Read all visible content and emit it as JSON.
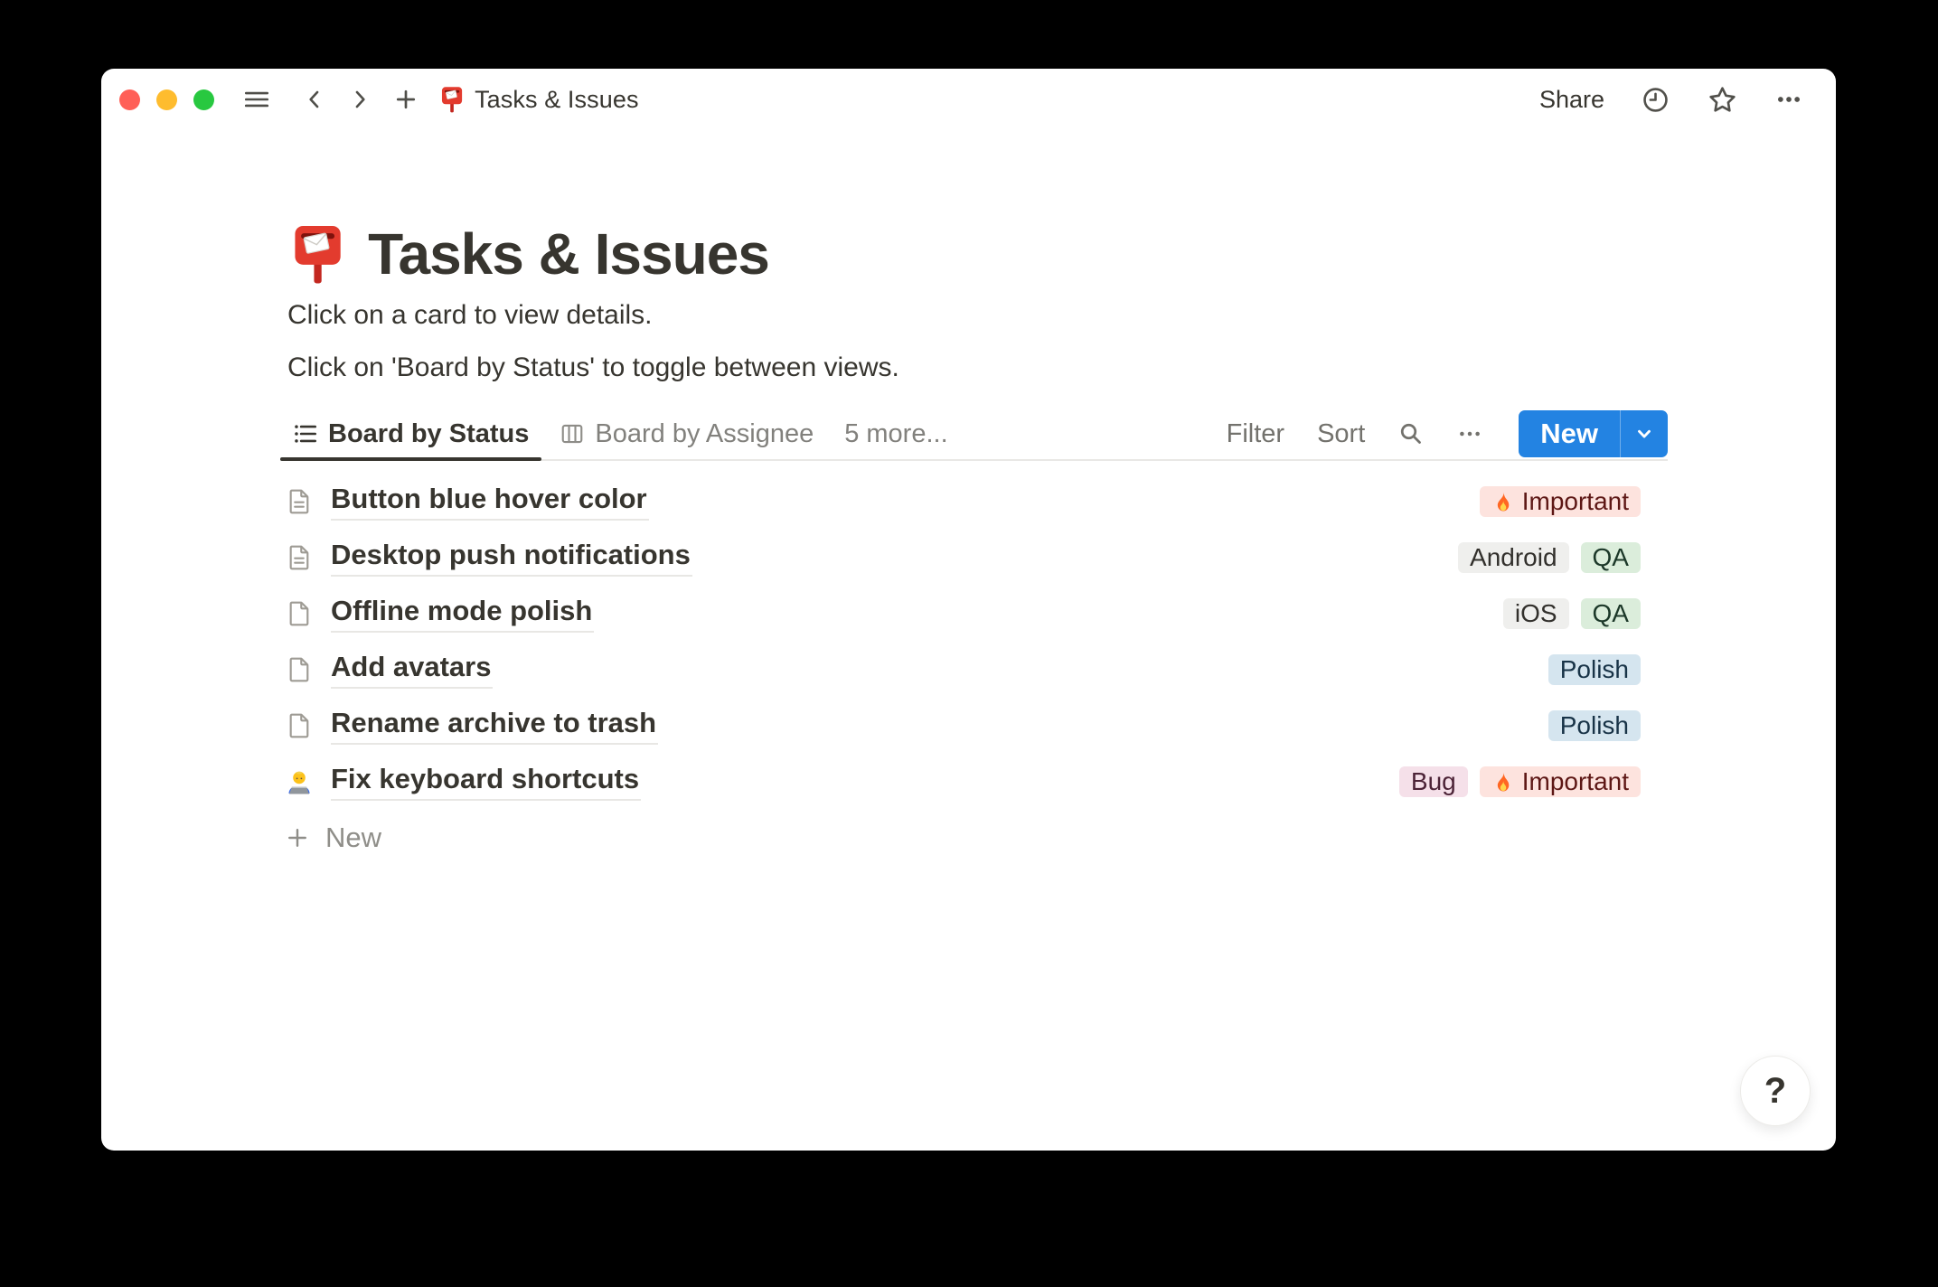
{
  "titlebar": {
    "breadcrumb": "Tasks & Issues",
    "share_label": "Share",
    "icons": [
      "sidebar-menu-icon",
      "back-icon",
      "forward-icon",
      "new-tab-icon",
      "mailbox-icon",
      "clock-icon",
      "star-icon",
      "more-icon"
    ]
  },
  "page": {
    "emoji": "mailbox-emoji",
    "title": "Tasks & Issues",
    "description_line1": "Click on a card to view details.",
    "description_line2": "Click on 'Board by Status' to toggle between views.",
    "new_row_label": "New",
    "help_label": "?"
  },
  "tabs": [
    {
      "label": "Board by Status",
      "icon": "list-view",
      "active": true
    },
    {
      "label": "Board by Assignee",
      "icon": "board-view",
      "active": false
    },
    {
      "label": "5 more...",
      "icon": null,
      "active": false
    }
  ],
  "view_controls": {
    "filter_label": "Filter",
    "sort_label": "Sort",
    "new_label": "New",
    "icons": [
      "search-icon",
      "view-options-icon",
      "chevron-down-icon"
    ]
  },
  "rows": [
    {
      "icon": "page-text",
      "title": "Button blue hover color",
      "tags": [
        {
          "label": "Important",
          "color": "red",
          "flame": true
        }
      ]
    },
    {
      "icon": "page-text",
      "title": "Desktop push notifications",
      "tags": [
        {
          "label": "Android",
          "color": "gray"
        },
        {
          "label": "QA",
          "color": "green"
        }
      ]
    },
    {
      "icon": "page-blank",
      "title": "Offline mode polish",
      "tags": [
        {
          "label": "iOS",
          "color": "gray"
        },
        {
          "label": "QA",
          "color": "green"
        }
      ]
    },
    {
      "icon": "page-blank",
      "title": "Add avatars",
      "tags": [
        {
          "label": "Polish",
          "color": "blue"
        }
      ]
    },
    {
      "icon": "page-blank",
      "title": "Rename archive to trash",
      "tags": [
        {
          "label": "Polish",
          "color": "blue"
        }
      ]
    },
    {
      "icon": "technologist",
      "title": "Fix keyboard shortcuts",
      "tags": [
        {
          "label": "Bug",
          "color": "pink"
        },
        {
          "label": "Important",
          "color": "red",
          "flame": true
        }
      ]
    }
  ],
  "colors": {
    "accent_blue": "#2383E2",
    "text_dark": "#37352F",
    "tag_red_bg": "#FDE3DE",
    "tag_red_text": "#5D1715",
    "tag_gray_bg": "#EFEFED",
    "tag_green_bg": "#DBEDDB",
    "tag_blue_bg": "#D5E5EF",
    "tag_pink_bg": "#F5E0E9",
    "traffic_red": "#FF5F57",
    "traffic_yellow": "#FEBC2E",
    "traffic_green": "#28C840"
  }
}
